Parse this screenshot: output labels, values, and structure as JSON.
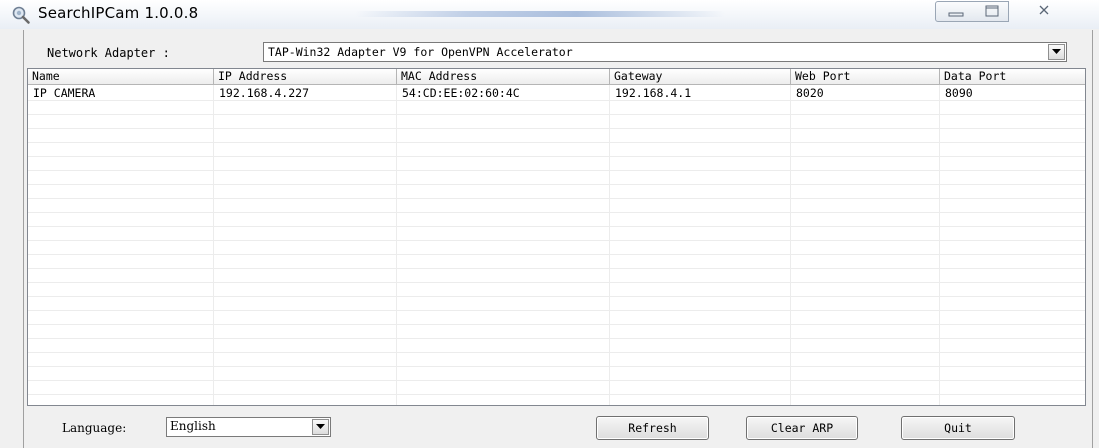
{
  "window": {
    "title": "SearchIPCam 1.0.0.8"
  },
  "adapter": {
    "label": "Network Adapter :",
    "selected": "TAP-Win32 Adapter V9 for OpenVPN Accelerator"
  },
  "table": {
    "columns": [
      "Name",
      "IP Address",
      "MAC Address",
      "Gateway",
      "Web Port",
      "Data Port"
    ],
    "rows": [
      [
        "IP CAMERA",
        "192.168.4.227",
        "54:CD:EE:02:60:4C",
        "192.168.4.1",
        "8020",
        "8090"
      ]
    ]
  },
  "footer": {
    "language_label": "Language:",
    "language_selected": "English",
    "refresh_label": "Refresh",
    "clear_arp_label": "Clear ARP",
    "quit_label": "Quit"
  },
  "icons": {
    "app": "magnifier-camera-icon",
    "minimize": "minimize-icon",
    "maximize": "maximize-icon",
    "close": "close-icon",
    "dropdown": "chevron-down-icon"
  }
}
